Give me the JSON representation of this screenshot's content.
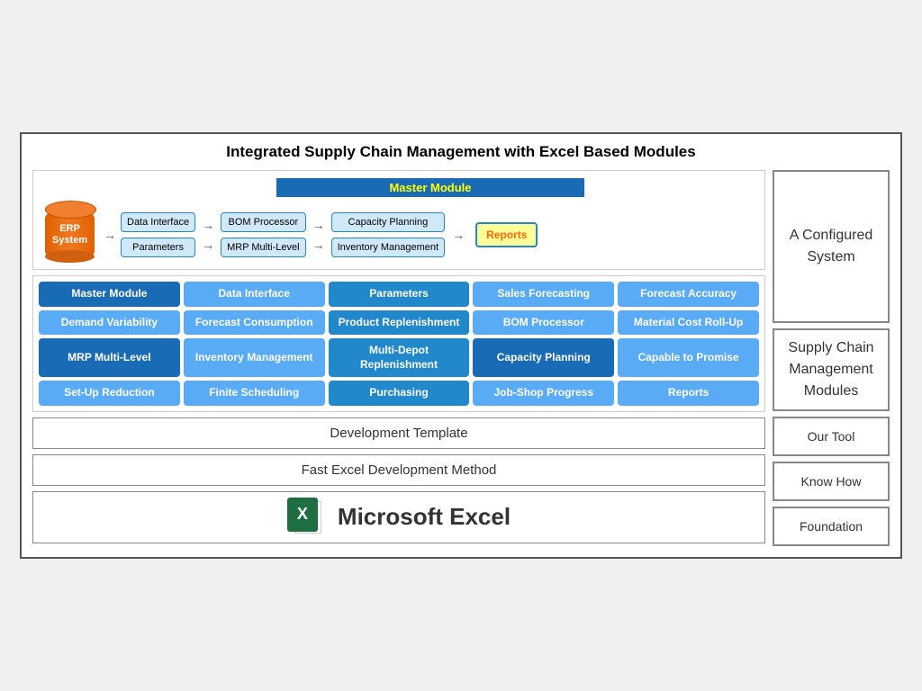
{
  "title": "Integrated Supply Chain Management with Excel Based Modules",
  "diagram": {
    "master_module_label": "Master Module",
    "erp_label": "ERP System",
    "flow": {
      "col1": [
        "Data Interface",
        "Parameters"
      ],
      "col2": [
        "BOM Processor",
        "MRP Multi-Level"
      ],
      "col3": [
        "Capacity Planning",
        "Inventory Management"
      ],
      "reports": "Reports"
    }
  },
  "modules": [
    {
      "label": "Master Module",
      "style": "blue-dark"
    },
    {
      "label": "Data Interface",
      "style": "blue-light"
    },
    {
      "label": "Parameters",
      "style": "blue-medium"
    },
    {
      "label": "Sales Forecasting",
      "style": "blue-light"
    },
    {
      "label": "Forecast Accuracy",
      "style": "blue-light"
    },
    {
      "label": "Demand Variability",
      "style": "blue-light"
    },
    {
      "label": "Forecast Consumption",
      "style": "blue-light"
    },
    {
      "label": "Product Replenishment",
      "style": "blue-medium"
    },
    {
      "label": "BOM Processor",
      "style": "blue-light"
    },
    {
      "label": "Material Cost Roll-Up",
      "style": "blue-light"
    },
    {
      "label": "MRP Multi-Level",
      "style": "blue-dark"
    },
    {
      "label": "Inventory Management",
      "style": "blue-light"
    },
    {
      "label": "Multi-Depot Replenishment",
      "style": "blue-medium"
    },
    {
      "label": "Capacity Planning",
      "style": "blue-dark"
    },
    {
      "label": "Capable to Promise",
      "style": "blue-light"
    },
    {
      "label": "Set-Up Reduction",
      "style": "blue-light"
    },
    {
      "label": "Finite Scheduling",
      "style": "blue-light"
    },
    {
      "label": "Purchasing",
      "style": "blue-medium"
    },
    {
      "label": "Job-Shop Progress",
      "style": "blue-light"
    },
    {
      "label": "Reports",
      "style": "blue-light"
    }
  ],
  "bottom": {
    "dev_template": "Development Template",
    "fast_excel": "Fast Excel Development Method",
    "excel_label": "Microsoft Excel"
  },
  "right_panel": {
    "configured_system": "A Configured System",
    "supply_chain": "Supply Chain Management Modules",
    "our_tool": "Our Tool",
    "know_how": "Know How",
    "foundation": "Foundation"
  }
}
